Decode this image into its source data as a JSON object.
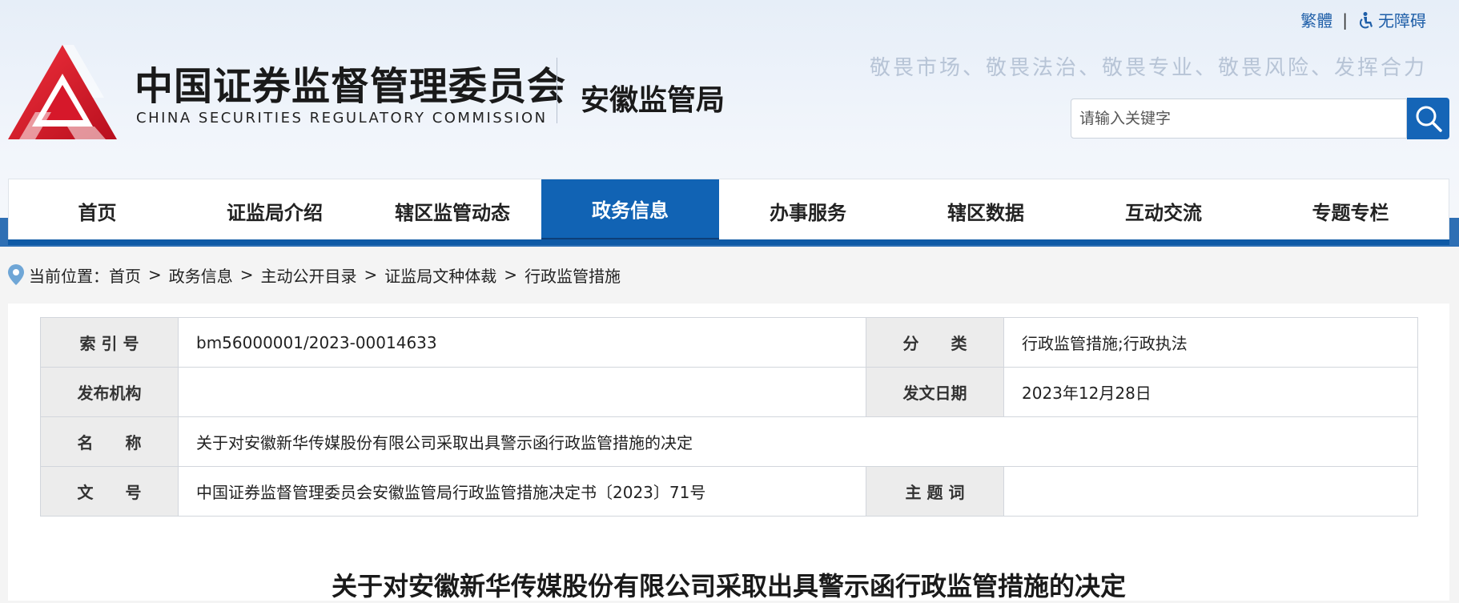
{
  "header": {
    "org_name_cn": "中国证券监督管理委员会",
    "org_name_en": "CHINA SECURITIES REGULATORY COMMISSION",
    "bureau": "安徽监管局",
    "slogan": "敬畏市场、敬畏法治、敬畏专业、敬畏风险、发挥合力",
    "top_links": {
      "traditional": "繁體",
      "separator": "|",
      "accessibility": "无障碍"
    },
    "search": {
      "placeholder": "请输入关键字"
    },
    "colors": {
      "logo_red": "#d6182a",
      "brand_blue": "#1163b4"
    }
  },
  "nav": {
    "items": [
      {
        "label": "首页"
      },
      {
        "label": "证监局介绍"
      },
      {
        "label": "辖区监管动态"
      },
      {
        "label": "政务信息",
        "active": true
      },
      {
        "label": "办事服务"
      },
      {
        "label": "辖区数据"
      },
      {
        "label": "互动交流"
      },
      {
        "label": "专题专栏"
      }
    ]
  },
  "breadcrumb": {
    "prefix": "当前位置：",
    "items": [
      "首页",
      "政务信息",
      "主动公开目录",
      "证监局文种体裁",
      "行政监管措施"
    ],
    "separator": ">"
  },
  "meta": {
    "index_label": "索 引 号",
    "index_value": "bm56000001/2023-00014633",
    "category_label": "分　　类",
    "category_value": "行政监管措施;行政执法",
    "publisher_label": "发布机构",
    "publisher_value": "",
    "date_label": "发文日期",
    "date_value": "2023年12月28日",
    "name_label": "名　　称",
    "name_value": "关于对安徽新华传媒股份有限公司采取出具警示函行政监管措施的决定",
    "docno_label": "文　　号",
    "docno_value": "中国证券监督管理委员会安徽监管局行政监管措施决定书〔2023〕71号",
    "keywords_label": "主 题 词",
    "keywords_value": ""
  },
  "document": {
    "title": "关于对安徽新华传媒股份有限公司采取出具警示函行政监管措施的决定"
  }
}
